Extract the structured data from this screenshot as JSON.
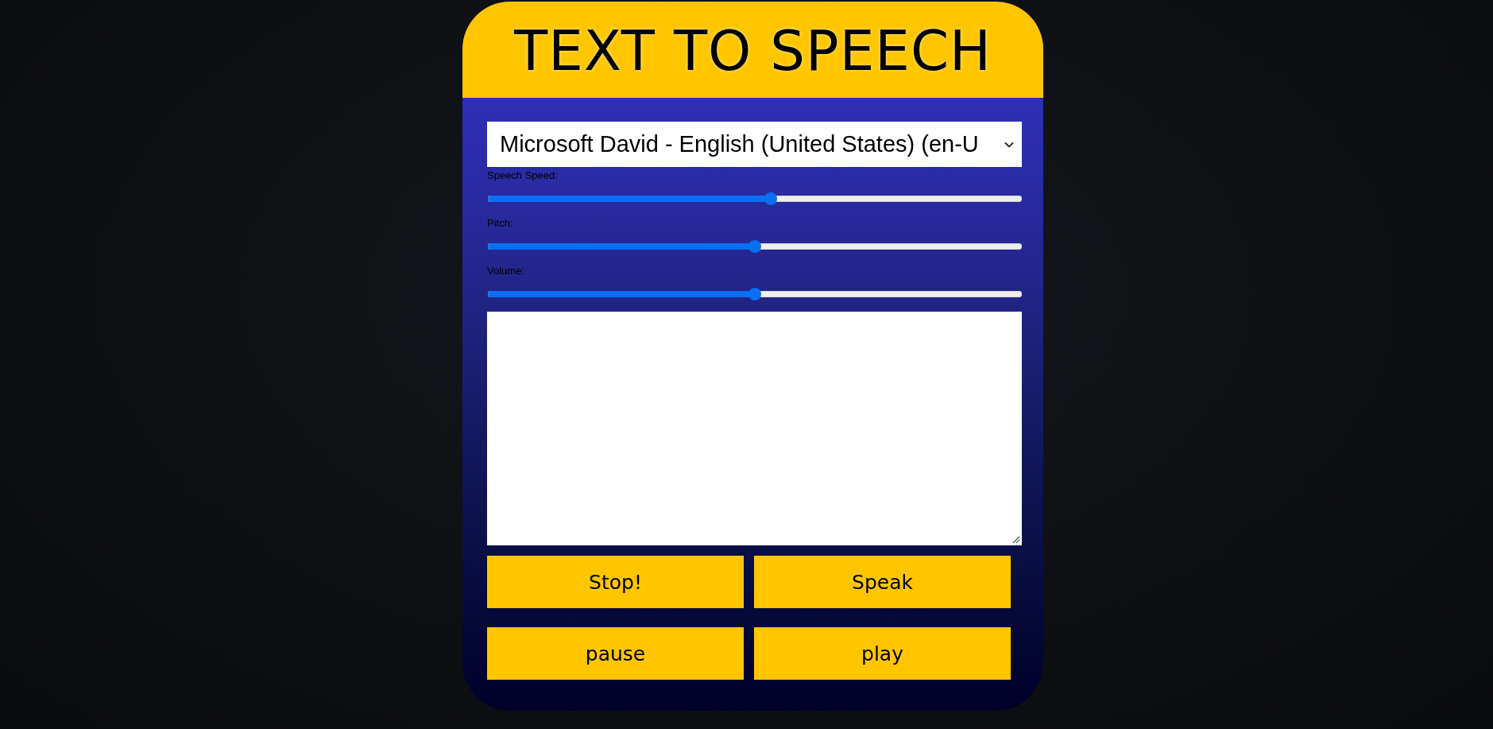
{
  "header": {
    "title": "TEXT TO SPEECH"
  },
  "voice_select": {
    "value": "Microsoft David - English (United States) (en-U"
  },
  "sliders": [
    {
      "label": "Speech Speed:",
      "level": 0.53
    },
    {
      "label": "Pitch:",
      "level": 0.5
    },
    {
      "label": "Volume:",
      "level": 0.5
    }
  ],
  "buttons": [
    {
      "label": "Stop!"
    },
    {
      "label": "Speak"
    },
    {
      "label": "pause"
    },
    {
      "label": "play"
    }
  ]
}
